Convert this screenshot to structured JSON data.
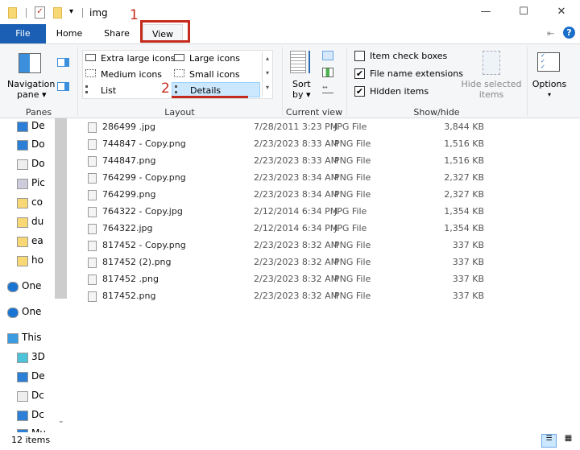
{
  "window": {
    "title": "img",
    "minimize": "—",
    "maximize": "☐",
    "close": "✕"
  },
  "tabs": [
    {
      "label": "File"
    },
    {
      "label": "Home"
    },
    {
      "label": "Share"
    },
    {
      "label": "View"
    }
  ],
  "annotations": {
    "step1": "1",
    "step2": "2",
    "accent": "#c42b1c"
  },
  "ribbon": {
    "panes": {
      "nav_pane": "Navigation",
      "nav_pane2": "pane ▾",
      "group": "Panes"
    },
    "layout": {
      "items": [
        "Extra large icons",
        "Large icons",
        "Medium icons",
        "Small icons",
        "List",
        "Details"
      ],
      "selected": "Details",
      "group": "Layout"
    },
    "current_view": {
      "sort": "Sort",
      "sort2": "by ▾",
      "group": "Current view"
    },
    "show_hide": {
      "item_check_boxes": {
        "label": "Item check boxes",
        "checked": false
      },
      "file_name_extensions": {
        "label": "File name extensions",
        "checked": true
      },
      "hidden_items": {
        "label": "Hidden items",
        "checked": true
      },
      "hide_selected": "Hide selected",
      "hide_selected2": "items",
      "group": "Show/hide"
    },
    "options": {
      "label": "Options",
      "arrow": "▾"
    }
  },
  "nav": [
    "De",
    "Do",
    "Do",
    "Pic",
    "co",
    "du",
    "ea",
    "ho",
    "One",
    "One",
    "This",
    "3D",
    "De",
    "Dc",
    "Dc",
    "Mu"
  ],
  "files": [
    [
      "286499 .jpg",
      "7/28/2011 3:23 PM",
      "JPG File",
      "3,844 KB"
    ],
    [
      "744847 - Copy.png",
      "2/23/2023 8:33 AM",
      "PNG File",
      "1,516 KB"
    ],
    [
      "744847.png",
      "2/23/2023 8:33 AM",
      "PNG File",
      "1,516 KB"
    ],
    [
      "764299 - Copy.png",
      "2/23/2023 8:34 AM",
      "PNG File",
      "2,327 KB"
    ],
    [
      "764299.png",
      "2/23/2023 8:34 AM",
      "PNG File",
      "2,327 KB"
    ],
    [
      "764322 - Copy.jpg",
      "2/12/2014 6:34 PM",
      "JPG File",
      "1,354 KB"
    ],
    [
      "764322.jpg",
      "2/12/2014 6:34 PM",
      "JPG File",
      "1,354 KB"
    ],
    [
      "817452 - Copy.png",
      "2/23/2023 8:32 AM",
      "PNG File",
      "337 KB"
    ],
    [
      "817452 (2).png",
      "2/23/2023 8:32 AM",
      "PNG File",
      "337 KB"
    ],
    [
      "817452 .png",
      "2/23/2023 8:32 AM",
      "PNG File",
      "337 KB"
    ],
    [
      "817452.png",
      "2/23/2023 8:32 AM",
      "PNG File",
      "337 KB"
    ]
  ],
  "status": {
    "count": "12 items"
  }
}
